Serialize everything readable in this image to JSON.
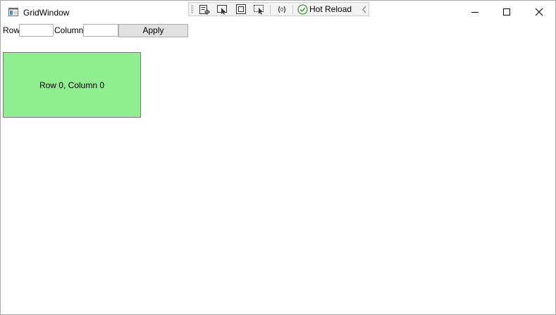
{
  "window": {
    "title": "GridWindow"
  },
  "devtools": {
    "hot_reload_label": "Hot Reload",
    "icons": [
      "live-visual-tree-icon",
      "select-element-icon",
      "display-layout-adorners-icon",
      "track-focused-element-icon",
      "binding-failures-icon",
      "hot-reload-status-icon",
      "collapse-chevron-icon"
    ],
    "status_color": "#3c9a3c"
  },
  "controls": {
    "row_label": "Row",
    "row_value": "",
    "column_label": "Column",
    "column_value": "",
    "apply_label": "Apply"
  },
  "grid": {
    "cell_label": "Row 0, Column 0",
    "cell_color": "#90ee90"
  }
}
